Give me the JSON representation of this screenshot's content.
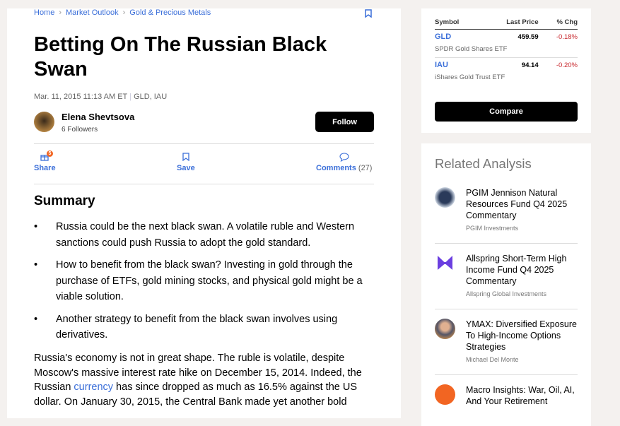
{
  "breadcrumb": [
    "Home",
    "Market Outlook",
    "Gold & Precious Metals"
  ],
  "article": {
    "title": "Betting On The Russian Black Swan",
    "date": "Mar. 11, 2015 11:13 AM ET",
    "tickers": "GLD, IAU",
    "author": "Elena Shevtsova",
    "followers": "6 Followers",
    "follow_label": "Follow",
    "share_label": "Share",
    "share_badge": "5",
    "save_label": "Save",
    "comments_label": "Comments",
    "comments_count": "(27)",
    "summary_heading": "Summary",
    "summary": [
      "Russia could be the next black swan. A volatile ruble and Western sanctions could push Russia to adopt the gold standard.",
      "How to benefit from the black swan? Investing in gold through the purchase of ETFs, gold mining stocks, and physical gold might be a viable solution.",
      "Another strategy to benefit from the black swan involves using derivatives."
    ],
    "para_a": "Russia's economy is not in great shape. The ruble is volatile, despite Moscow's massive interest rate hike on December 15, 2014. Indeed, the Russian ",
    "para_link": "currency",
    "para_b": " has since dropped as much as 16.5% against the US dollar. On January 30, 2015, the Central Bank made yet another bold"
  },
  "quotes": {
    "headers": [
      "Symbol",
      "Last Price",
      "% Chg"
    ],
    "rows": [
      {
        "symbol": "GLD",
        "price": "459.59",
        "chg": "-0.18%",
        "name": "SPDR Gold Shares ETF"
      },
      {
        "symbol": "IAU",
        "price": "94.14",
        "chg": "-0.20%",
        "name": "iShares Gold Trust ETF"
      }
    ],
    "compare_label": "Compare"
  },
  "related": {
    "heading": "Related Analysis",
    "items": [
      {
        "title": "PGIM Jennison Natural Resources Fund Q4 2025 Commentary",
        "source": "PGIM Investments"
      },
      {
        "title": "Allspring Short-Term High Income Fund Q4 2025 Commentary",
        "source": "Allspring Global Investments"
      },
      {
        "title": "YMAX: Diversified Exposure To High-Income Options Strategies",
        "source": "Michael Del Monte"
      },
      {
        "title": "Macro Insights: War, Oil, AI, And Your Retirement",
        "source": ""
      }
    ]
  }
}
